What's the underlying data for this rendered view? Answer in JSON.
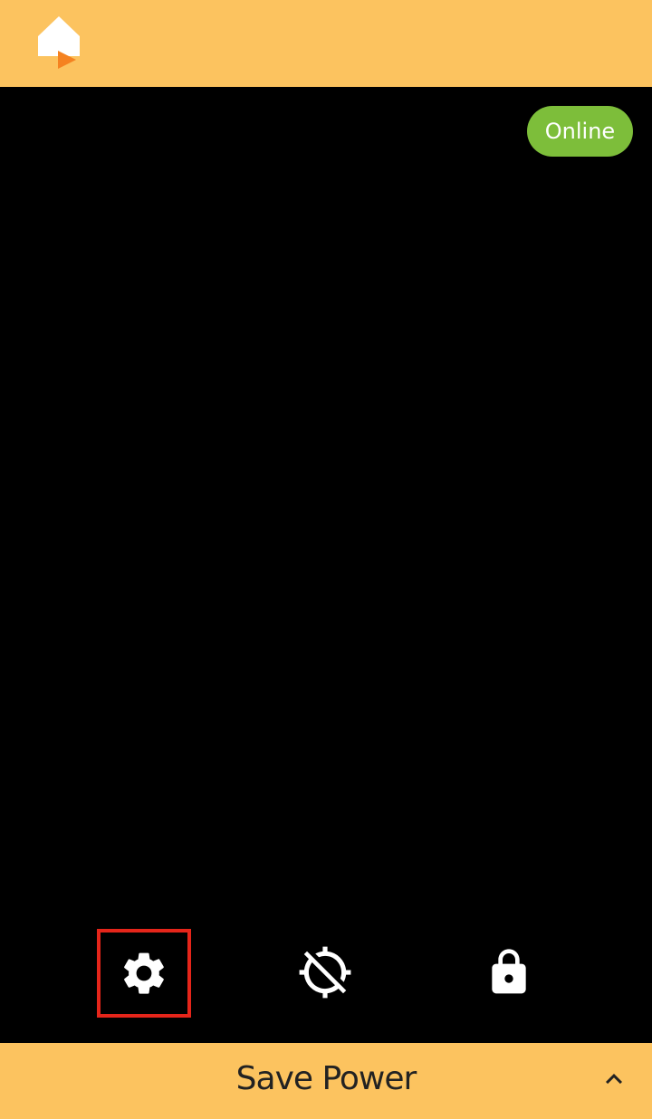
{
  "header": {
    "logo_icon": "home-play-logo-icon",
    "background_color": "#FCC35F"
  },
  "status": {
    "label": "Online",
    "color": "#7DBE3A"
  },
  "toolbar": {
    "items": [
      {
        "icon": "gear-icon",
        "selected": true
      },
      {
        "icon": "location-disabled-icon",
        "selected": false
      },
      {
        "icon": "lock-icon",
        "selected": false
      }
    ],
    "highlight_color": "#E5251A"
  },
  "footer": {
    "label": "Save Power",
    "chevron_icon": "chevron-up-icon"
  }
}
